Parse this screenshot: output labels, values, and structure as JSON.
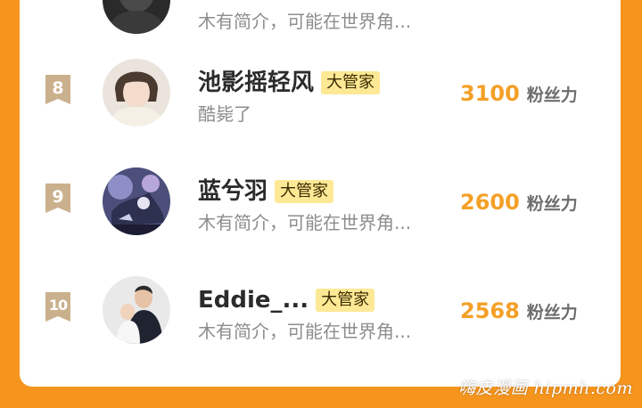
{
  "colors": {
    "page_background": "#f6951e",
    "card_background": "#ffffff",
    "fans_count": "#f3a028",
    "badge_background": "#fde995",
    "rank_flag": "#cbb08e"
  },
  "ranking": {
    "rows": [
      {
        "rank": "",
        "name": "",
        "badge": "",
        "bio": "木有简介，可能在世界角...",
        "fans": "",
        "fans_label": "",
        "avatar_icon": "dark-avatar-partial"
      },
      {
        "rank": "8",
        "name": "池影摇轻风",
        "badge": "大管家",
        "bio": "酷毙了",
        "fans": "3100",
        "fans_label": "粉丝力",
        "avatar_icon": "person-avatar"
      },
      {
        "rank": "9",
        "name": "蓝兮羽",
        "badge": "大管家",
        "bio": "木有简介，可能在世界角...",
        "fans": "2600",
        "fans_label": "粉丝力",
        "avatar_icon": "anime-avatar"
      },
      {
        "rank": "10",
        "name": "Eddie_...",
        "badge": "大管家",
        "bio": "木有简介，可能在世界角...",
        "fans": "2568",
        "fans_label": "粉丝力",
        "avatar_icon": "person-avatar"
      }
    ]
  },
  "watermark": "嗨皮漫画 hipmh.com"
}
